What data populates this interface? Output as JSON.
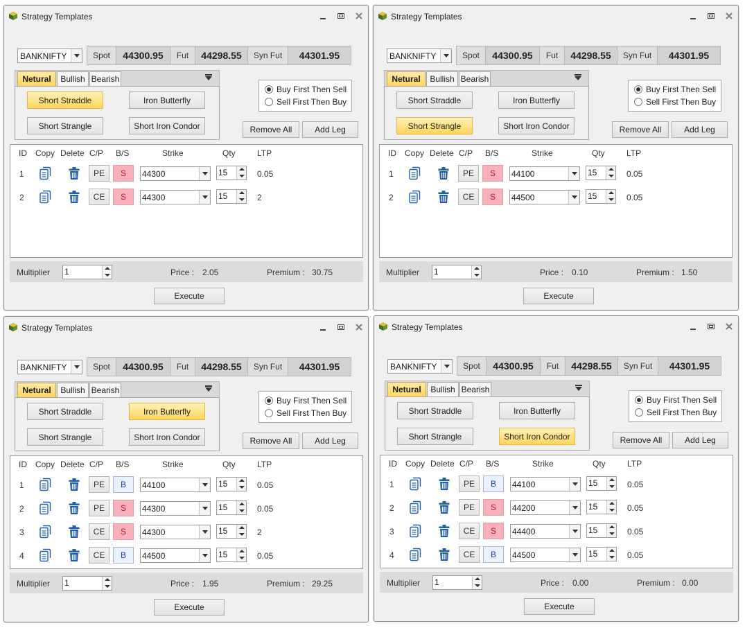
{
  "common": {
    "title": "Strategy Templates",
    "symbol": "BANKNIFTY",
    "spot_label": "Spot",
    "spot_value": "44300.95",
    "fut_label": "Fut",
    "fut_value": "44298.55",
    "synfut_label": "Syn Fut",
    "synfut_value": "44301.95",
    "tabs": [
      "Netural",
      "Bullish",
      "Bearish"
    ],
    "active_tab": 0,
    "strategies": [
      "Short Straddle",
      "Iron Butterfly",
      "Short Strangle",
      "Short Iron Condor"
    ],
    "radio_options": [
      "Buy First Then Sell",
      "Sell First Then Buy"
    ],
    "radio_selected": 0,
    "remove_all_label": "Remove All",
    "add_leg_label": "Add Leg",
    "headers": [
      "ID",
      "Copy",
      "Delete",
      "C/P",
      "B/S",
      "Strike",
      "Qty",
      "LTP"
    ],
    "multiplier_label": "Multiplier",
    "price_label": "Price :",
    "premium_label": "Premium :",
    "execute_label": "Execute"
  },
  "windows": [
    {
      "selected_strategy": 0,
      "multiplier": "1",
      "price": "2.05",
      "premium": "30.75",
      "legs": [
        {
          "id": "1",
          "cp": "PE",
          "bs": "S",
          "strike": "44300",
          "qty": "15",
          "ltp": "0.05"
        },
        {
          "id": "2",
          "cp": "CE",
          "bs": "S",
          "strike": "44300",
          "qty": "15",
          "ltp": "2"
        }
      ]
    },
    {
      "selected_strategy": 2,
      "multiplier": "1",
      "price": "0.10",
      "premium": "1.50",
      "legs": [
        {
          "id": "1",
          "cp": "PE",
          "bs": "S",
          "strike": "44100",
          "qty": "15",
          "ltp": "0.05"
        },
        {
          "id": "2",
          "cp": "CE",
          "bs": "S",
          "strike": "44500",
          "qty": "15",
          "ltp": "0.05"
        }
      ]
    },
    {
      "selected_strategy": 1,
      "multiplier": "1",
      "price": "1.95",
      "premium": "29.25",
      "legs": [
        {
          "id": "1",
          "cp": "PE",
          "bs": "B",
          "strike": "44100",
          "qty": "15",
          "ltp": "0.05"
        },
        {
          "id": "2",
          "cp": "PE",
          "bs": "S",
          "strike": "44300",
          "qty": "15",
          "ltp": "0.05"
        },
        {
          "id": "3",
          "cp": "CE",
          "bs": "S",
          "strike": "44300",
          "qty": "15",
          "ltp": "2"
        },
        {
          "id": "4",
          "cp": "CE",
          "bs": "B",
          "strike": "44500",
          "qty": "15",
          "ltp": "0.05"
        }
      ]
    },
    {
      "selected_strategy": 3,
      "multiplier": "1",
      "price": "0.00",
      "premium": "0.00",
      "legs": [
        {
          "id": "1",
          "cp": "PE",
          "bs": "B",
          "strike": "44100",
          "qty": "15",
          "ltp": "0.05"
        },
        {
          "id": "2",
          "cp": "PE",
          "bs": "S",
          "strike": "44200",
          "qty": "15",
          "ltp": "0.05"
        },
        {
          "id": "3",
          "cp": "CE",
          "bs": "S",
          "strike": "44400",
          "qty": "15",
          "ltp": "0.05"
        },
        {
          "id": "4",
          "cp": "CE",
          "bs": "B",
          "strike": "44500",
          "qty": "15",
          "ltp": "0.05"
        }
      ]
    }
  ]
}
